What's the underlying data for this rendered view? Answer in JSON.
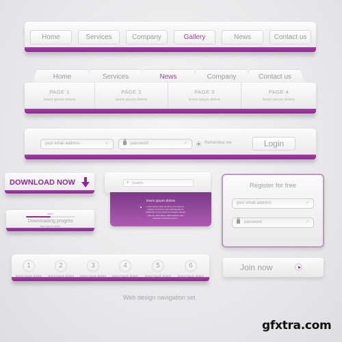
{
  "nav_bar_1": {
    "items": [
      {
        "label": "Home",
        "active": false
      },
      {
        "label": "Services",
        "active": false
      },
      {
        "label": "Company",
        "active": false
      },
      {
        "label": "Gallery",
        "active": true
      },
      {
        "label": "News",
        "active": false
      },
      {
        "label": "Contact us",
        "active": false
      }
    ]
  },
  "nav_bar_2": {
    "tabs": [
      {
        "label": "Home",
        "active": false
      },
      {
        "label": "Services",
        "active": false
      },
      {
        "label": "News",
        "active": true
      },
      {
        "label": "Company",
        "active": false
      },
      {
        "label": "Contact us",
        "active": false
      }
    ],
    "pages": [
      {
        "title": "PAGE 1",
        "subtitle": "lorem ipsum dolore"
      },
      {
        "title": "PAGE 2",
        "subtitle": "lorem ipsum dolore"
      },
      {
        "title": "PAGE 3",
        "subtitle": "lorem ipsum dolore"
      },
      {
        "title": "PAGE 4",
        "subtitle": "lorem ipsum dolore"
      }
    ]
  },
  "login_bar": {
    "email_placeholder": "your email address",
    "password_placeholder": "password",
    "remember_label": "Remember me",
    "login_label": "Login",
    "check_glyph": "✓"
  },
  "download": {
    "label": "DOWNLOAD NOW",
    "icon": "download-arrow-icon"
  },
  "progress": {
    "percent_label": "50%",
    "value": 0.5,
    "title": "Downloading progres",
    "subtitle": "lorem ipsum dolore"
  },
  "search_panel": {
    "placeholder": "Search",
    "heading": "lorem ipsum dolore",
    "body": "Lorem ipsum dolor sit amet, commodo et, tristique urna lorem sed pellentesque ac sollicitudin. Proin morbi leo curabitur laoreet odio dui, diam lacus. Vitae dapibus quis parturient sed fusce urna in."
  },
  "register": {
    "title": "Register for free",
    "email_placeholder": "your email address",
    "password_placeholder": "password"
  },
  "steps": {
    "items": [
      {
        "number": "1",
        "label": "lorem ipsum dolore"
      },
      {
        "number": "2",
        "label": "lorem ipsum dolore"
      },
      {
        "number": "3",
        "label": "lorem ipsum dolore"
      },
      {
        "number": "4",
        "label": "lorem ipsum dolore"
      },
      {
        "number": "5",
        "label": "lorem ipsum dolore"
      },
      {
        "number": "6",
        "label": "lorem ipsum dolore"
      }
    ]
  },
  "join": {
    "label": "Join now",
    "icon": "play-icon"
  },
  "caption": "Web design navigation set",
  "watermark": "gfxtra.com",
  "colors": {
    "accent": "#9b3ea3",
    "accent_dark": "#8e2a93",
    "text_muted": "#9a9a9c",
    "background": "#e8e8ea"
  }
}
